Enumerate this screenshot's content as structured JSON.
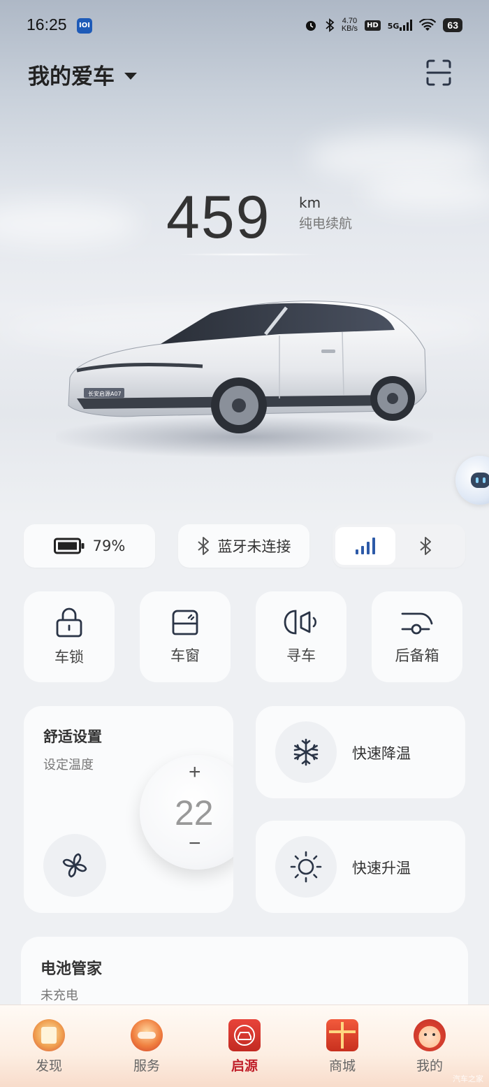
{
  "status_bar": {
    "time": "16:25",
    "speed_value": "4.70",
    "speed_unit": "KB/s",
    "hd": "HD",
    "network": "5G",
    "battery": "63"
  },
  "header": {
    "title": "我的爱车"
  },
  "range": {
    "value": "459",
    "unit": "km",
    "label": "纯电续航"
  },
  "status_row": {
    "battery_percent": "79%",
    "bluetooth_status": "蓝牙未连接"
  },
  "controls": [
    {
      "label": "车锁",
      "icon": "lock-icon"
    },
    {
      "label": "车窗",
      "icon": "window-icon"
    },
    {
      "label": "寻车",
      "icon": "headlight-icon"
    },
    {
      "label": "后备箱",
      "icon": "trunk-icon"
    }
  ],
  "comfort": {
    "title": "舒适设置",
    "subtitle": "设定温度",
    "plus": "+",
    "temperature": "22",
    "minus": "−"
  },
  "quick_actions": {
    "cool_label": "快速降温",
    "heat_label": "快速升温"
  },
  "battery_manager": {
    "title": "电池管家",
    "status": "未充电"
  },
  "bottom_nav": {
    "items": [
      "发现",
      "服务",
      "启源",
      "商城",
      "我的"
    ],
    "active_index": 2
  },
  "watermark": "汽车之家",
  "colors": {
    "accent_blue": "#1e5bb8",
    "nav_active": "#c0202a",
    "background": "#eef0f3"
  }
}
